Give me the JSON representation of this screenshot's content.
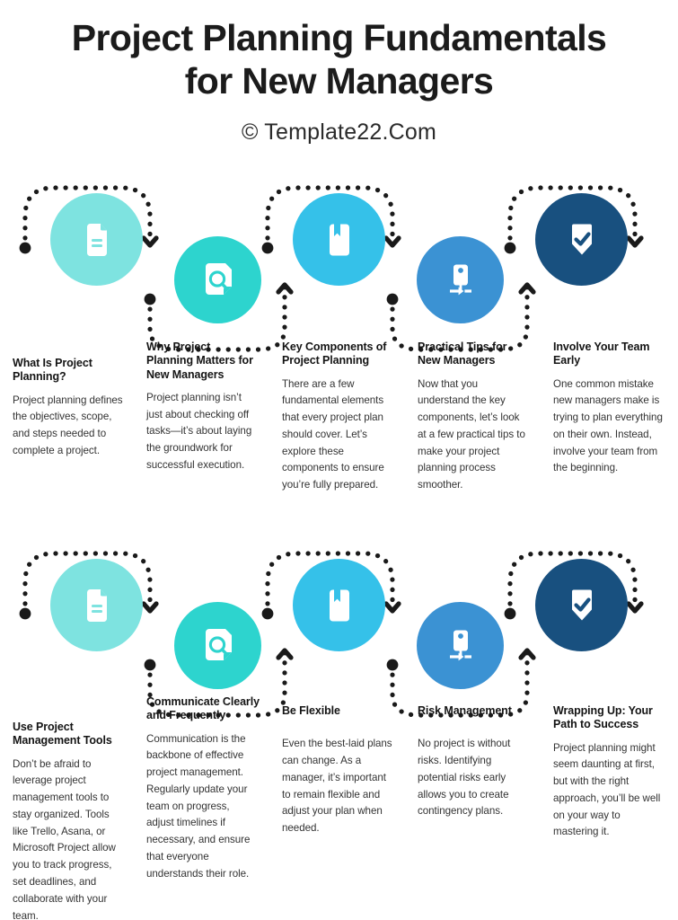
{
  "header": {
    "title_line1": "Project Planning Fundamentals",
    "title_line2": "for New Managers",
    "credit": "© Template22.Com"
  },
  "colors": {
    "circle_1": "#7EE3E0",
    "circle_2": "#2DD4CE",
    "circle_3": "#35C1E9",
    "circle_4": "#3B92D3",
    "circle_5": "#18507F",
    "connector": "#1a1a1a",
    "title_text": "#141414",
    "body_text": "#333333"
  },
  "rows": [
    {
      "id": "row-1",
      "steps": [
        {
          "icon": "document-icon",
          "color": "#7EE3E0",
          "position": "up",
          "title": "What Is Project Planning?",
          "body": "Project planning defines the objectives, scope, and steps needed to complete a project."
        },
        {
          "icon": "document-search-icon",
          "color": "#2DD4CE",
          "position": "down",
          "title": "Why Project Planning Matters for New Managers",
          "body": "Project planning isn’t just about checking off tasks—it’s about laying the groundwork for successful execution."
        },
        {
          "icon": "bookmark-book-icon",
          "color": "#35C1E9",
          "position": "up",
          "title": "Key Components of Project Planning",
          "body": "There are a few fundamental elements that every project plan should cover. Let’s explore these components to ensure you’re fully prepared."
        },
        {
          "icon": "org-chart-icon",
          "color": "#3B92D3",
          "position": "down",
          "title": "Practical Tips for New Managers",
          "body": "Now that you understand the key components, let’s look at a few practical tips to make your project planning process smoother."
        },
        {
          "icon": "shield-check-icon",
          "color": "#18507F",
          "position": "up",
          "title": "Involve Your Team Early",
          "body": "One common mistake new managers make is trying to plan everything on their own. Instead, involve your team from the beginning."
        }
      ]
    },
    {
      "id": "row-2",
      "steps": [
        {
          "icon": "document-icon",
          "color": "#7EE3E0",
          "position": "up",
          "title": "Use Project Management Tools",
          "body": "Don’t be afraid to leverage project management tools to stay organized. Tools like Trello, Asana, or Microsoft Project allow you to track progress, set deadlines, and collaborate with your team."
        },
        {
          "icon": "document-search-icon",
          "color": "#2DD4CE",
          "position": "down",
          "title": "Communicate Clearly and Frequently",
          "body": "Communication is the backbone of effective project management. Regularly update your team on progress, adjust timelines if necessary, and ensure that everyone understands their role."
        },
        {
          "icon": "bookmark-book-icon",
          "color": "#35C1E9",
          "position": "up",
          "title": "Be Flexible",
          "body": "Even the best-laid plans can change. As a manager, it’s important to remain flexible and adjust your plan when needed."
        },
        {
          "icon": "org-chart-icon",
          "color": "#3B92D3",
          "position": "down",
          "title": "Risk Management",
          "body": "No project is without risks. Identifying potential risks early allows you to create contingency plans."
        },
        {
          "icon": "shield-check-icon",
          "color": "#18507F",
          "position": "up",
          "title": "Wrapping Up: Your Path to Success",
          "body": "Project planning might seem daunting at first, but with the right approach, you’ll be well on your way to mastering it."
        }
      ]
    }
  ]
}
